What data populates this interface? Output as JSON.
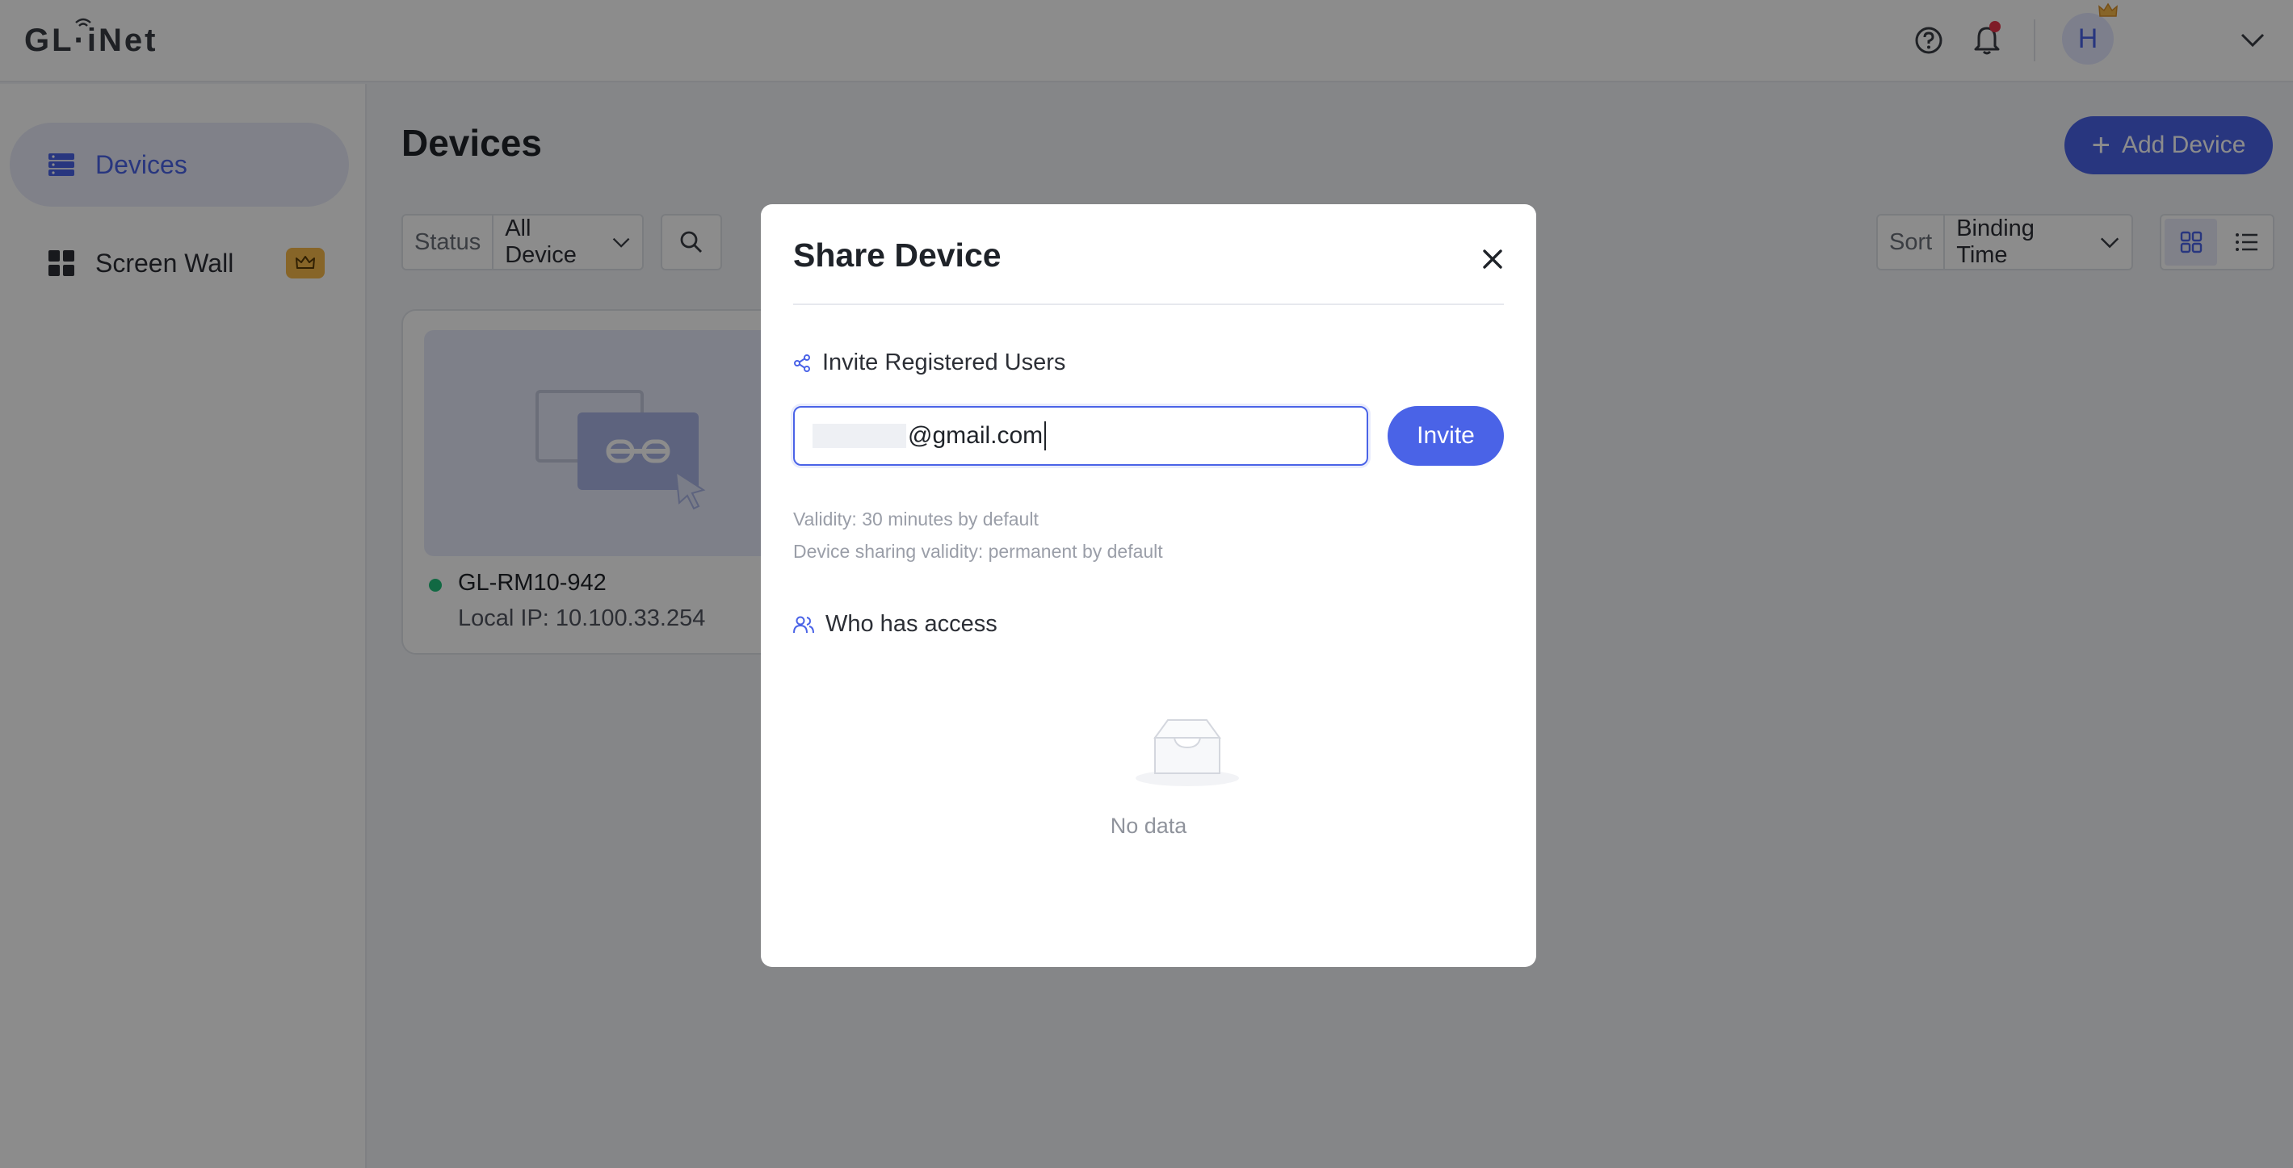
{
  "app": {
    "logo_text": "GL·iNet",
    "user_initial": "H"
  },
  "colors": {
    "accent": "#4a63e7",
    "online": "#1fc07a",
    "notification": "#e8334a",
    "premium": "#f6b84a"
  },
  "header": {
    "icons": [
      "help-icon",
      "bell-icon",
      "chevron-down-icon"
    ]
  },
  "sidebar": {
    "items": [
      {
        "label": "Devices",
        "icon": "devices-icon",
        "active": true
      },
      {
        "label": "Screen Wall",
        "icon": "grid-icon",
        "premium": true
      }
    ]
  },
  "main": {
    "title": "Devices",
    "add_device_label": "Add Device",
    "status_filter": {
      "label": "Status",
      "value": "All Device"
    },
    "sort_filter": {
      "label": "Sort",
      "value": "Binding Time"
    },
    "view_mode": "grid",
    "devices": [
      {
        "name": "GL-RM10-942",
        "local_ip": "Local IP: 10.100.33.254",
        "online": true
      }
    ]
  },
  "modal": {
    "title": "Share Device",
    "invite_section_title": "Invite Registered Users",
    "email_value": "@gmail.com",
    "invite_label": "Invite",
    "validity_hint": "Validity: 30 minutes by default",
    "sharing_hint": "Device sharing validity: permanent by default",
    "access_section_title": "Who has access",
    "empty_text": "No data"
  }
}
